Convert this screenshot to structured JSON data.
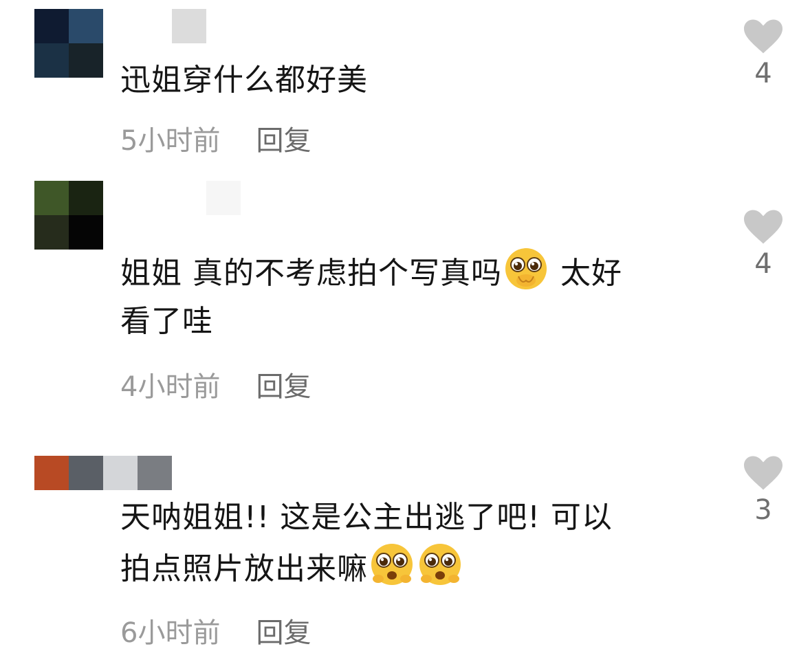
{
  "comments": [
    {
      "text_line1": "迅姐穿什么都好美",
      "text_line2": "",
      "emoji_after": "",
      "time": "5小时前",
      "reply_label": "回复",
      "likes": "4",
      "avatar_colors": [
        "#0f1b31",
        "#2a4a6a",
        "#1b3145",
        "#182329"
      ],
      "name_colors": [
        "#ffffff",
        "#dcdcdc"
      ]
    },
    {
      "text_line1_a": "姐姐 真的不考虑拍个写真吗",
      "text_line1_b": " 太好",
      "text_line2": "看了哇",
      "time": "4小时前",
      "reply_label": "回复",
      "likes": "4",
      "avatar_colors": [
        "#3f5728",
        "#1a2412",
        "#262c1c",
        "#050505"
      ],
      "name_colors": [
        "#ffffff",
        "#f6f6f6"
      ]
    },
    {
      "text_line1": "天呐姐姐!! 这是公主出逃了吧! 可以",
      "text_line2": "拍点照片放出来嘛",
      "time": "6小时前",
      "reply_label": "回复",
      "likes": "3",
      "name_colors": [
        "#b84a24",
        "#5a5f66",
        "#d4d6d9",
        "#7a7d82"
      ]
    }
  ],
  "icons": {
    "like": "heart-icon",
    "emoji": "pleading-face-emoji-icon"
  },
  "colors": {
    "heart": "#c8c8c8",
    "meta_text": "#9a9a9a",
    "body_text": "#151515"
  }
}
